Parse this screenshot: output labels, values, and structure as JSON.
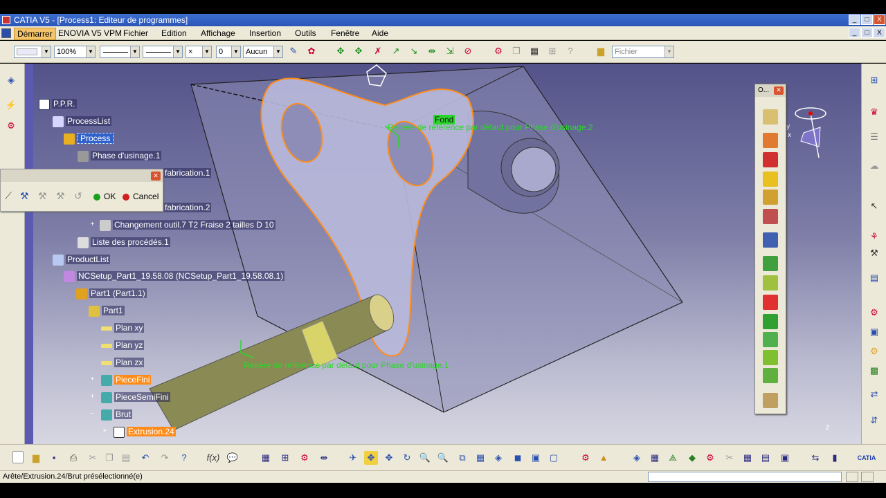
{
  "window": {
    "title": "CATIA V5 - [Process1: Editeur de programmes]",
    "controls": [
      "_",
      "□",
      "X"
    ],
    "inner_controls": [
      "_",
      "□",
      "X"
    ]
  },
  "menu": {
    "items": [
      "Démarrer",
      "ENOVIA V5 VPM",
      "Fichier",
      "Edition",
      "Affichage",
      "Insertion",
      "Outils",
      "Fenêtre",
      "Aide"
    ]
  },
  "toolbar": {
    "zoom_value": "100%",
    "layer_value": "Aucun",
    "file_value": "Fichier",
    "lineweight_value": "0"
  },
  "tree": {
    "root": "P.P.R.",
    "process_list": "ProcessList",
    "process": "Process",
    "phase": "Phase d'usinage.1",
    "fab1": "fabrication.1",
    "fab2": "fabrication.2",
    "tool_change": "Changement outil.7  T2 Fraise 2 tailles D 10",
    "procedures": "Liste des procédés.1",
    "product_list": "ProductList",
    "ncsetup": "NCSetup_Part1_19.58.08 (NCSetup_Part1_19.58.08.1)",
    "part1_inst": "Part1 (Part1.1)",
    "part1": "Part1",
    "plane_xy": "Plan xy",
    "plane_yz": "Plan yz",
    "plane_zx": "Plan zx",
    "piece_fini": "PieceFini",
    "piece_semi": "PieceSemiFini",
    "brut": "Brut",
    "extrusion": "Extrusion.24"
  },
  "dialog": {
    "ok_label": "OK",
    "cancel_label": "Cancel"
  },
  "viewport": {
    "label_fond": "Fond",
    "label_ref2": "Repère de référence par défaut pour Phase d'usinage.2",
    "label_ref1": "Repère de référence par défaut pour Phase d'usinage.1",
    "axis_z": "z",
    "axis_y": "y",
    "axis_x": "x",
    "accent_orange": "#ff8c1a",
    "accent_green": "#2bd62b"
  },
  "float_panel": {
    "title": "O..."
  },
  "status": {
    "text": "Arête/Extrusion.24/Brut présélectionné(e)"
  },
  "icons": [
    "search-icon",
    "catia-logo"
  ]
}
